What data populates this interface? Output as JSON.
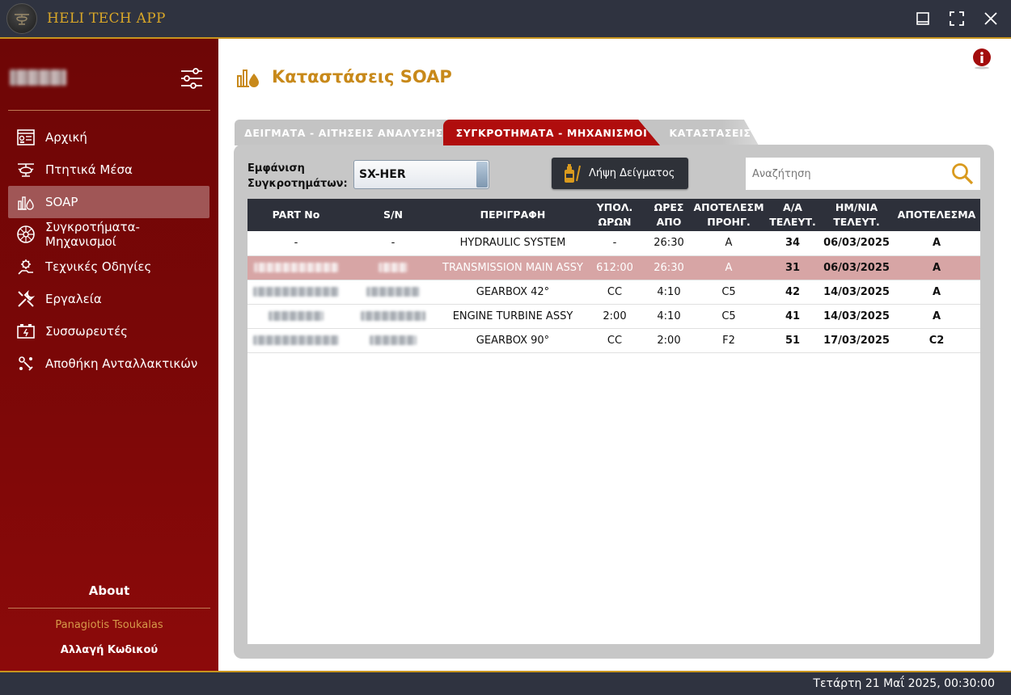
{
  "app": {
    "title": "HELI TECH APP"
  },
  "sidebar": {
    "items": [
      {
        "label": "Αρχική",
        "icon": "dashboard-icon"
      },
      {
        "label": "Πτητικά Μέσα",
        "icon": "helicopter-icon"
      },
      {
        "label": "SOAP",
        "icon": "oil-chart-icon"
      },
      {
        "label": "Συγκροτήματα-Μηχανισμοί",
        "icon": "turbine-icon"
      },
      {
        "label": "Τεχνικές Οδηγίες",
        "icon": "gear-hand-icon"
      },
      {
        "label": "Εργαλεία",
        "icon": "tools-icon"
      },
      {
        "label": "Συσσωρευτές",
        "icon": "battery-icon"
      },
      {
        "label": "Αποθήκη Ανταλλακτικών",
        "icon": "parts-icon"
      }
    ],
    "active_index": 2,
    "about": "About",
    "user_fullname": "Panagiotis Tsoukalas",
    "change_password": "Αλλαγή Κωδικού"
  },
  "page": {
    "title": "Καταστάσεις SOAP",
    "tabs": [
      {
        "label": "ΔΕΙΓΜΑΤΑ - ΑΙΤΗΣΕΙΣ ΑΝΑΛΥΣΗΣ"
      },
      {
        "label": "ΣΥΓΚΡΟΤΗΜΑΤΑ - ΜΗΧΑΝΙΣΜΟΙ"
      },
      {
        "label": "ΚΑΤΑΣΤΑΣΕΙΣ"
      }
    ],
    "active_tab": 1
  },
  "filter": {
    "label_line1": "Εμφάνιση",
    "label_line2": "Συγκροτημάτων:",
    "selected": "SX-HER"
  },
  "actions": {
    "take_sample": "Λήψη Δείγματος"
  },
  "search": {
    "placeholder": "Αναζήτηση",
    "value": ""
  },
  "table": {
    "columns": [
      [
        "PART No"
      ],
      [
        "S/N"
      ],
      [
        "ΠΕΡΙΓΡΑΦΗ"
      ],
      [
        "ΥΠΟΛ.",
        "ΩΡΩΝ"
      ],
      [
        "ΩΡΕΣ",
        "ΑΠΟ"
      ],
      [
        "ΑΠΟΤΕΛΕΣΜ",
        "ΠΡΟΗΓ."
      ],
      [
        "Α/Α",
        "ΤΕΛΕΥΤ."
      ],
      [
        "ΗΜ/ΝΙΑ",
        "ΤΕΛΕΥΤ."
      ],
      [
        "ΑΠΟΤΕΛΕΣΜΑ"
      ]
    ],
    "rows": [
      {
        "part_no": "-",
        "sn": "-",
        "description": "HYDRAULIC SYSTEM",
        "remaining": "-",
        "hours_since": "26:30",
        "prev_result": "A",
        "last_no": "34",
        "last_date": "06/03/2025",
        "result": "A",
        "selected": false
      },
      {
        "part_no": "",
        "sn": "",
        "description": "TRANSMISSION MAIN ASSY",
        "remaining": "612:00",
        "hours_since": "26:30",
        "prev_result": "A",
        "last_no": "31",
        "last_date": "06/03/2025",
        "result": "A",
        "selected": true
      },
      {
        "part_no": "",
        "sn": "",
        "description": "GEARBOX 42°",
        "remaining": "CC",
        "hours_since": "4:10",
        "prev_result": "C5",
        "last_no": "42",
        "last_date": "14/03/2025",
        "result": "A",
        "selected": false
      },
      {
        "part_no": "",
        "sn": "",
        "description": "ENGINE TURBINE ASSY",
        "remaining": "2:00",
        "hours_since": "4:10",
        "prev_result": "C5",
        "last_no": "41",
        "last_date": "14/03/2025",
        "result": "A",
        "selected": false
      },
      {
        "part_no": "",
        "sn": "",
        "description": "GEARBOX 90°",
        "remaining": "CC",
        "hours_since": "2:00",
        "prev_result": "F2",
        "last_no": "51",
        "last_date": "17/03/2025",
        "result": "C2",
        "selected": false
      }
    ]
  },
  "status": {
    "datetime": "Τετάρτη 21 Μαΐ 2025, 00:30:00"
  },
  "colors": {
    "accent_gold": "#c8891a",
    "sidebar_red": "#7a0707",
    "tab_active": "#b00d0d",
    "selected_row": "#d7a5a5"
  }
}
